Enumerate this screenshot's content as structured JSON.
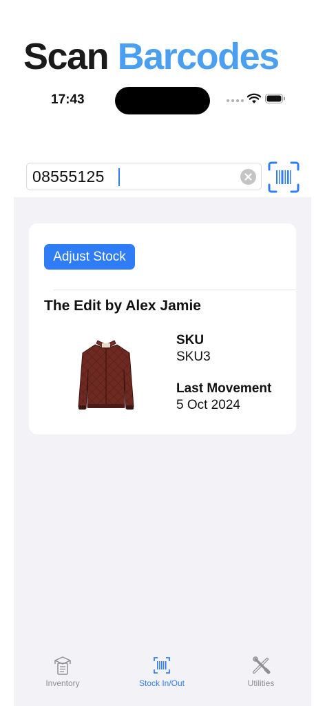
{
  "promo": {
    "word1": "Scan",
    "word2": "Barcodes"
  },
  "status": {
    "time": "17:43"
  },
  "search": {
    "value": "08555125"
  },
  "card": {
    "button_label": "Adjust Stock",
    "product_name": "The Edit by Alex Jamie",
    "sku_label": "SKU",
    "sku_value": "SKU3",
    "movement_label": "Last Movement",
    "movement_value": "5 Oct 2024"
  },
  "tabs": [
    {
      "label": "Inventory",
      "icon": "inventory-box-icon",
      "active": false
    },
    {
      "label": "Stock In/Out",
      "icon": "barcode-scan-icon",
      "active": true
    },
    {
      "label": "Utilities",
      "icon": "tools-icon",
      "active": false
    }
  ],
  "colors": {
    "accent": "#2f7df6",
    "promo_blue": "#4a9ff0",
    "background": "#f2f2f7"
  }
}
